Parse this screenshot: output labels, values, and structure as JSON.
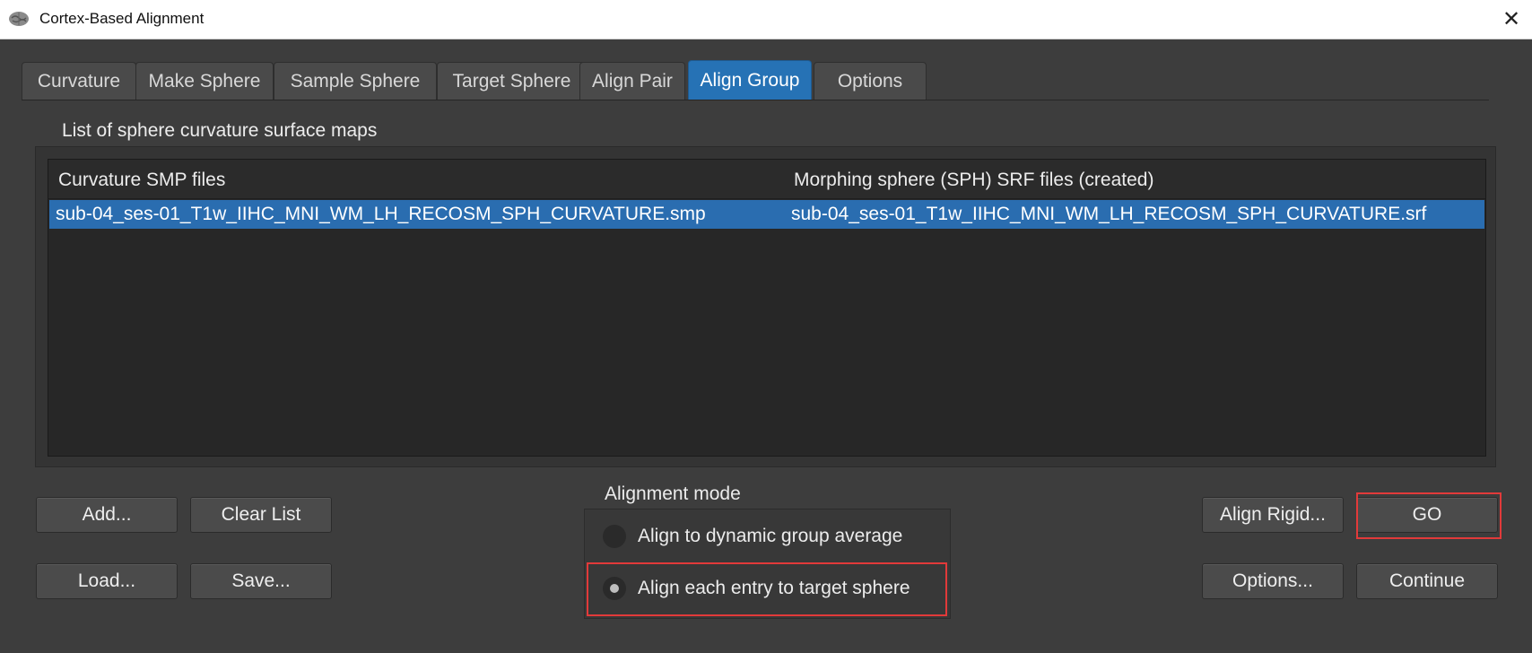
{
  "window": {
    "title": "Cortex-Based Alignment",
    "icon": "brain-icon",
    "close_glyph": "✕"
  },
  "tabs": [
    {
      "label": "Curvature",
      "active": false
    },
    {
      "label": "Make Sphere",
      "active": false
    },
    {
      "label": "Sample Sphere",
      "active": false
    },
    {
      "label": "Target Sphere",
      "active": false
    },
    {
      "label": "Align Pair",
      "active": false
    },
    {
      "label": "Align Group",
      "active": true
    },
    {
      "label": "Options",
      "active": false
    }
  ],
  "list_group": {
    "label": "List of sphere curvature surface maps",
    "columns": [
      "Curvature SMP files",
      "Morphing sphere (SPH) SRF files (created)"
    ],
    "rows": [
      {
        "smp": "sub-04_ses-01_T1w_IIHC_MNI_WM_LH_RECOSM_SPH_CURVATURE.smp",
        "srf": "sub-04_ses-01_T1w_IIHC_MNI_WM_LH_RECOSM_SPH_CURVATURE.srf",
        "selected": true
      }
    ]
  },
  "buttons": {
    "add": "Add...",
    "clear_list": "Clear List",
    "load": "Load...",
    "save": "Save...",
    "align_rigid": "Align Rigid...",
    "go": "GO",
    "options": "Options...",
    "continue": "Continue"
  },
  "alignment_mode": {
    "label": "Alignment mode",
    "options": [
      {
        "label": "Align to dynamic group average",
        "checked": false
      },
      {
        "label": "Align each entry to target sphere",
        "checked": true
      }
    ]
  },
  "colors": {
    "accent": "#2672b5",
    "highlight": "#e23a3a",
    "background": "#3d3d3d"
  }
}
